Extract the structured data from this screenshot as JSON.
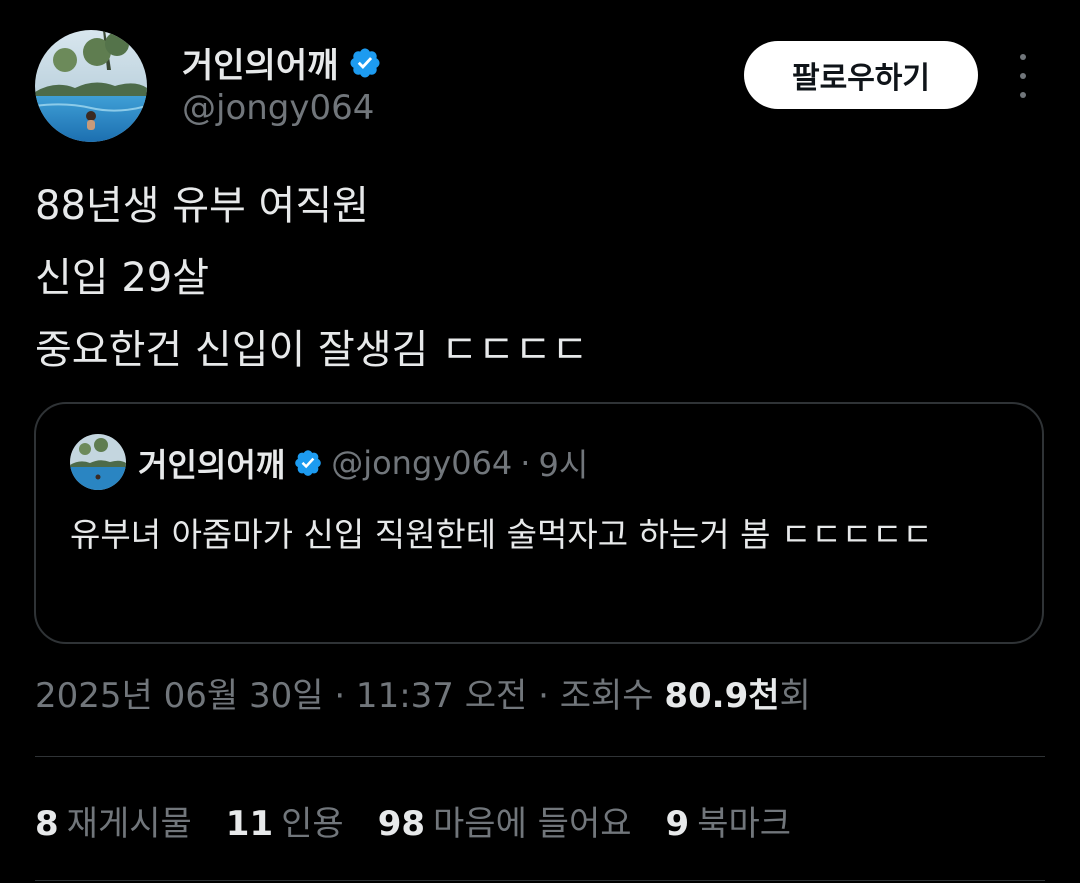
{
  "author": {
    "display_name": "거인의어깨",
    "handle": "@jongy064",
    "verified_icon": "verified-badge-icon",
    "verified_color": "#1d9bf0"
  },
  "header": {
    "follow_label": "팔로우하기",
    "more_icon": "more-vertical-icon"
  },
  "tweet": {
    "lines": [
      "88년생 유부 여직원",
      "신입 29살",
      "중요한건 신입이 잘생김 ㄷㄷㄷㄷ"
    ]
  },
  "quote": {
    "display_name": "거인의어깨",
    "handle": "@jongy064",
    "separator": "·",
    "time": "9시",
    "text": "유부녀 아줌마가 신입 직원한테 술먹자고 하는거 봄 ㄷㄷㄷㄷㄷ"
  },
  "meta": {
    "date_time": "2025년 06월 30일 · 11:37 오전 · 조회수 ",
    "views_count": "80.9천",
    "views_suffix": "회"
  },
  "stats": [
    {
      "count": "8",
      "label": "재게시물"
    },
    {
      "count": "11",
      "label": "인용"
    },
    {
      "count": "98",
      "label": "마음에 들어요"
    },
    {
      "count": "9",
      "label": "북마크"
    }
  ],
  "colors": {
    "background": "#000000",
    "text_primary": "#e7e9ea",
    "text_secondary": "#71767b",
    "border": "#2f3336",
    "accent": "#1d9bf0"
  }
}
